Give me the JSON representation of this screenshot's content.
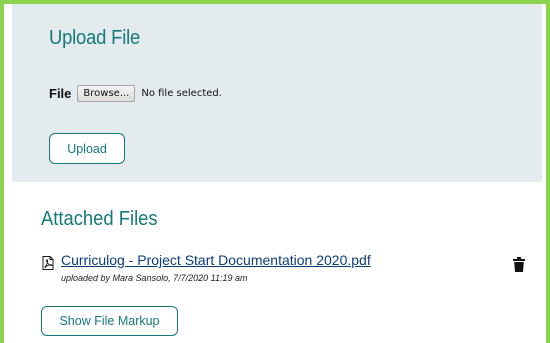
{
  "upload_section": {
    "title": "Upload File",
    "file_label": "File",
    "browse_label": "Browse...",
    "no_file_text": "No file selected.",
    "upload_button": "Upload"
  },
  "attached_section": {
    "title": "Attached Files",
    "files": [
      {
        "name": "Curriculog - Project Start Documentation 2020.pdf",
        "uploaded_by": "uploaded by Mara Sansolo, 7/7/2020 11:19 am",
        "icon": "pdf-icon",
        "delete_icon": "trash-icon"
      }
    ],
    "show_markup_button": "Show File Markup"
  },
  "colors": {
    "accent": "#15797b",
    "frame_border": "#8bd34e",
    "upload_panel_bg": "#e3ebee",
    "link": "#0a3d7a"
  }
}
